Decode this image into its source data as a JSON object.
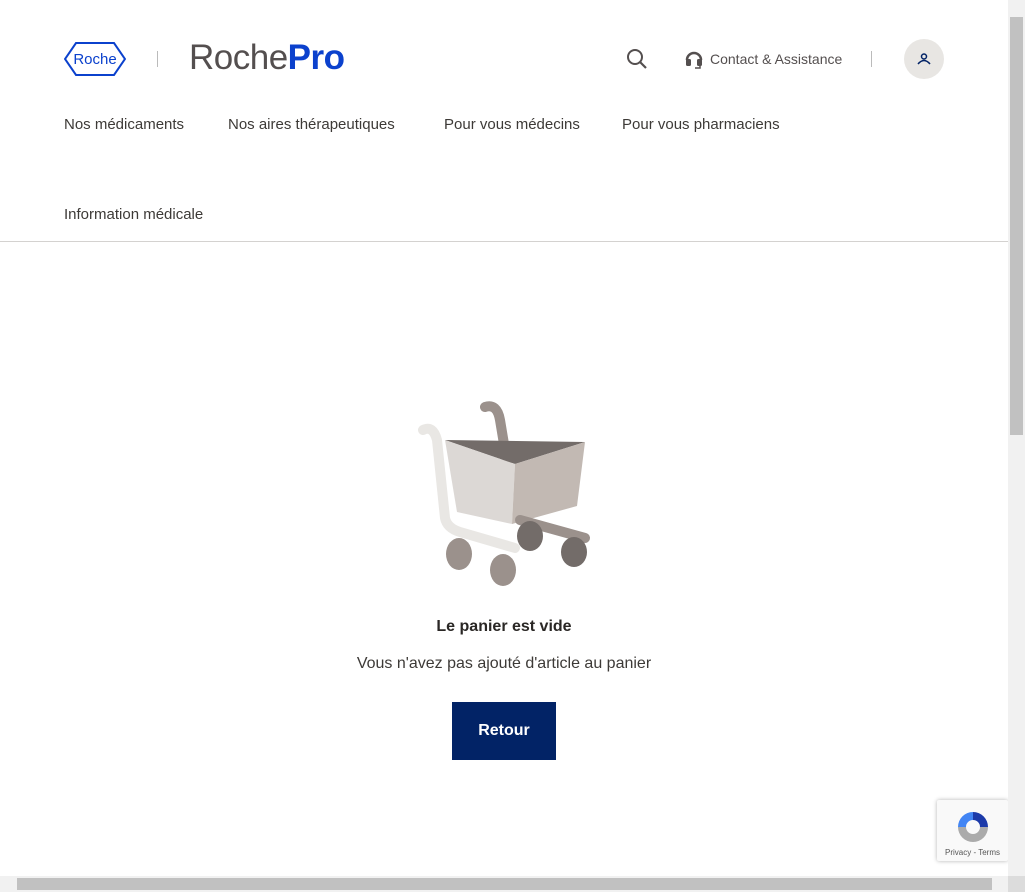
{
  "header": {
    "logo_text": "Roche",
    "brand_a": "Roche",
    "brand_b": "Pro",
    "contact": "Contact & Assistance"
  },
  "nav": [
    "Nos médicaments",
    "Nos aires thérapeutiques",
    "Pour vous médecins",
    "Pour vous pharmaciens",
    "Information médicale"
  ],
  "cart": {
    "title": "Le panier est vide",
    "message": "Vous n'avez pas ajouté d'article au panier",
    "button": "Retour"
  },
  "recaptcha": {
    "links": "Privacy - Terms"
  },
  "colors": {
    "brand_blue": "#0b41cd",
    "button": "#022366"
  }
}
